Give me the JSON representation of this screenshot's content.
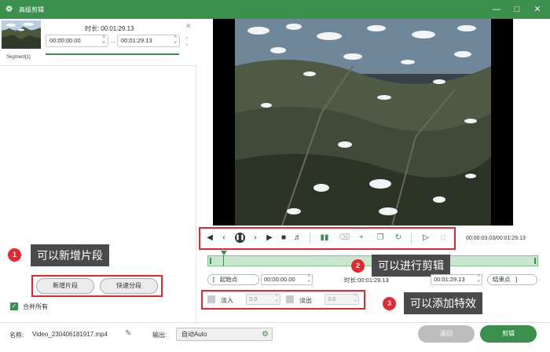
{
  "window": {
    "title": "高级剪辑",
    "minimize_icon": "minimize-icon",
    "maximize_icon": "maximize-icon",
    "close_icon": "close-icon"
  },
  "segment": {
    "label": "Segment[1]",
    "duration_label": "时长:",
    "duration_value": "00:01:29.13",
    "start_time": "00:00:00.00",
    "end_time": "00:01:29.13",
    "separator": "--"
  },
  "callouts": [
    {
      "num": "1",
      "text": "可以新增片段"
    },
    {
      "num": "2",
      "text": "可以进行剪辑"
    },
    {
      "num": "3",
      "text": "可以添加特效"
    }
  ],
  "left_buttons": {
    "add_segment": "新增片段",
    "quick_split": "快速分段"
  },
  "merge_all": {
    "label": "合并所有",
    "checked": true
  },
  "playback": {
    "time_readout": "00:00:03.03/00:01:29.13"
  },
  "range": {
    "start_label": "起始点",
    "start_value": "00:00:00.00",
    "length_label": "时长:",
    "length_value": "00:01:29.13",
    "end_value": "00:01:29.13",
    "end_label": "结束点"
  },
  "effects": {
    "fade_in_label": "淡入",
    "fade_in_value": "3.0",
    "fade_out_label": "淡出",
    "fade_out_value": "3.0"
  },
  "bottom": {
    "name_label": "名称:",
    "file_name": "Video_230406181917.mp4",
    "output_label": "输出:",
    "output_value": "自动Auto",
    "back_button": "返回",
    "edit_button": "剪辑"
  },
  "colors": {
    "accent": "#3a8f4c",
    "callout_red": "#e8262d",
    "callout_bg": "#4a4a4a"
  }
}
